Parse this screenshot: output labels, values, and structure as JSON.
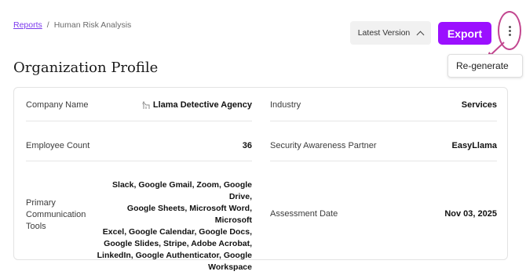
{
  "breadcrumb": {
    "root": "Reports",
    "separator": "/",
    "current": "Human Risk Analysis"
  },
  "version_select": {
    "label": "Latest Version"
  },
  "export_button": {
    "label": "Export"
  },
  "more_menu": {
    "item_regenerate": "Re-generate"
  },
  "page_title": "Organization Profile",
  "profile": {
    "company_name": {
      "label": "Company Name",
      "value": "Llama Detective Agency",
      "icon": "llama-icon"
    },
    "industry": {
      "label": "Industry",
      "value": "Services"
    },
    "employee_count": {
      "label": "Employee Count",
      "value": "36"
    },
    "security_partner": {
      "label": "Security Awareness Partner",
      "value": "EasyLlama"
    },
    "communication_tools": {
      "label_lines": [
        "Primary",
        "Communication",
        "Tools"
      ],
      "value_lines": [
        "Slack, Google Gmail, Zoom, Google Drive,",
        "Google Sheets, Microsoft Word, Microsoft",
        "Excel, Google Calendar, Google Docs,",
        "Google Slides, Stripe, Adobe Acrobat,",
        "LinkedIn, Google Authenticator, Google",
        "Workspace"
      ]
    },
    "assessment_date": {
      "label": "Assessment Date",
      "value": "Nov 03, 2025"
    }
  },
  "colors": {
    "accent": "#9b10ff",
    "annotation": "#c2468f",
    "link": "#7c3aed"
  }
}
